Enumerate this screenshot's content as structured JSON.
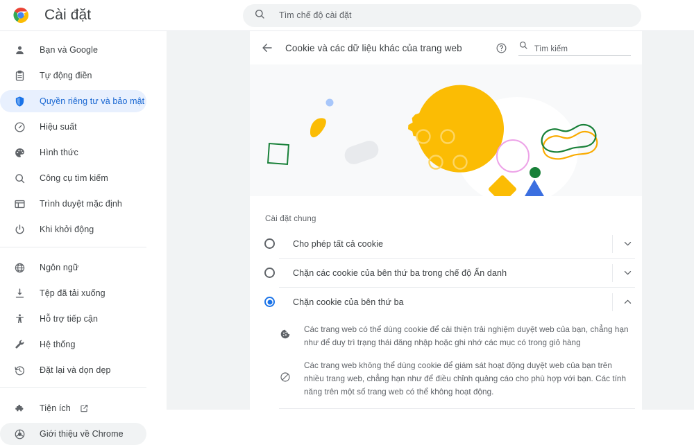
{
  "topbar": {
    "logo_icon": "chrome-logo-icon",
    "title": "Cài đặt",
    "search_icon": "search-icon",
    "search_placeholder": "Tìm chế độ cài đặt",
    "search_value": ""
  },
  "sidebar": {
    "groups": [
      {
        "items": [
          {
            "icon": "person-icon",
            "label": "Bạn và Google",
            "state": "normal"
          },
          {
            "icon": "clipboard-icon",
            "label": "Tự động điền",
            "state": "normal"
          },
          {
            "icon": "shield-icon",
            "label": "Quyền riêng tư và bảo mật",
            "state": "selected"
          },
          {
            "icon": "speedometer-icon",
            "label": "Hiệu suất",
            "state": "normal"
          },
          {
            "icon": "palette-icon",
            "label": "Hình thức",
            "state": "normal"
          },
          {
            "icon": "search-icon",
            "label": "Công cụ tìm kiếm",
            "state": "normal"
          },
          {
            "icon": "browser-icon",
            "label": "Trình duyệt mặc định",
            "state": "normal"
          },
          {
            "icon": "power-icon",
            "label": "Khi khởi động",
            "state": "normal"
          }
        ]
      },
      {
        "items": [
          {
            "icon": "globe-icon",
            "label": "Ngôn ngữ",
            "state": "normal"
          },
          {
            "icon": "download-icon",
            "label": "Tệp đã tải xuống",
            "state": "normal"
          },
          {
            "icon": "accessibility-icon",
            "label": "Hỗ trợ tiếp cận",
            "state": "normal"
          },
          {
            "icon": "wrench-icon",
            "label": "Hệ thống",
            "state": "normal"
          },
          {
            "icon": "restore-icon",
            "label": "Đặt lại và dọn dẹp",
            "state": "normal"
          }
        ]
      },
      {
        "items": [
          {
            "icon": "puzzle-icon",
            "label": "Tiện ích",
            "state": "normal",
            "trailing_icon": "external-link-icon"
          },
          {
            "icon": "chrome-ring-icon",
            "label": "Giới thiệu về Chrome",
            "state": "hovered"
          }
        ]
      }
    ]
  },
  "content": {
    "back_icon": "back-arrow-icon",
    "title": "Cookie và các dữ liệu khác của trang web",
    "help_icon": "help-circle-icon",
    "search_icon": "search-icon",
    "search_placeholder": "Tìm kiếm",
    "search_value": "",
    "banner_icon": "cookie-illustration",
    "section_title": "Cài đặt chung",
    "options": [
      {
        "label": "Cho phép tất cả cookie",
        "selected": false,
        "expanded": false,
        "chevron": "chevron-down-icon"
      },
      {
        "label": "Chặn các cookie của bên thứ ba trong chế độ Ẩn danh",
        "selected": false,
        "expanded": false,
        "chevron": "chevron-down-icon"
      },
      {
        "label": "Chặn cookie của bên thứ ba",
        "selected": true,
        "expanded": true,
        "chevron": "chevron-up-icon"
      }
    ],
    "details": [
      {
        "icon": "cookie-icon",
        "text": "Các trang web có thể dùng cookie để cải thiện trải nghiệm duyệt web của bạn, chẳng hạn như để duy trì trạng thái đăng nhập hoặc ghi nhớ các mục có trong giỏ hàng"
      },
      {
        "icon": "block-icon",
        "text": "Các trang web không thể dùng cookie để giám sát hoạt động duyệt web của bạn trên nhiều trang web, chẳng hạn như để điều chỉnh quảng cáo cho phù hợp với bạn. Các tính năng trên một số trang web có thể không hoạt động."
      }
    ]
  },
  "colors": {
    "accent_blue": "#1a73e8",
    "selected_pill": "#e8f0fe",
    "hover_pill": "#f1f3f4",
    "text_primary": "#3c4043",
    "text_secondary": "#5f6368",
    "page_bg": "#f1f3f4",
    "banner_bg": "#f8f9fa",
    "cookie_yellow": "#fbbc04",
    "green": "#188038",
    "blue_tri": "#1a73e8"
  }
}
